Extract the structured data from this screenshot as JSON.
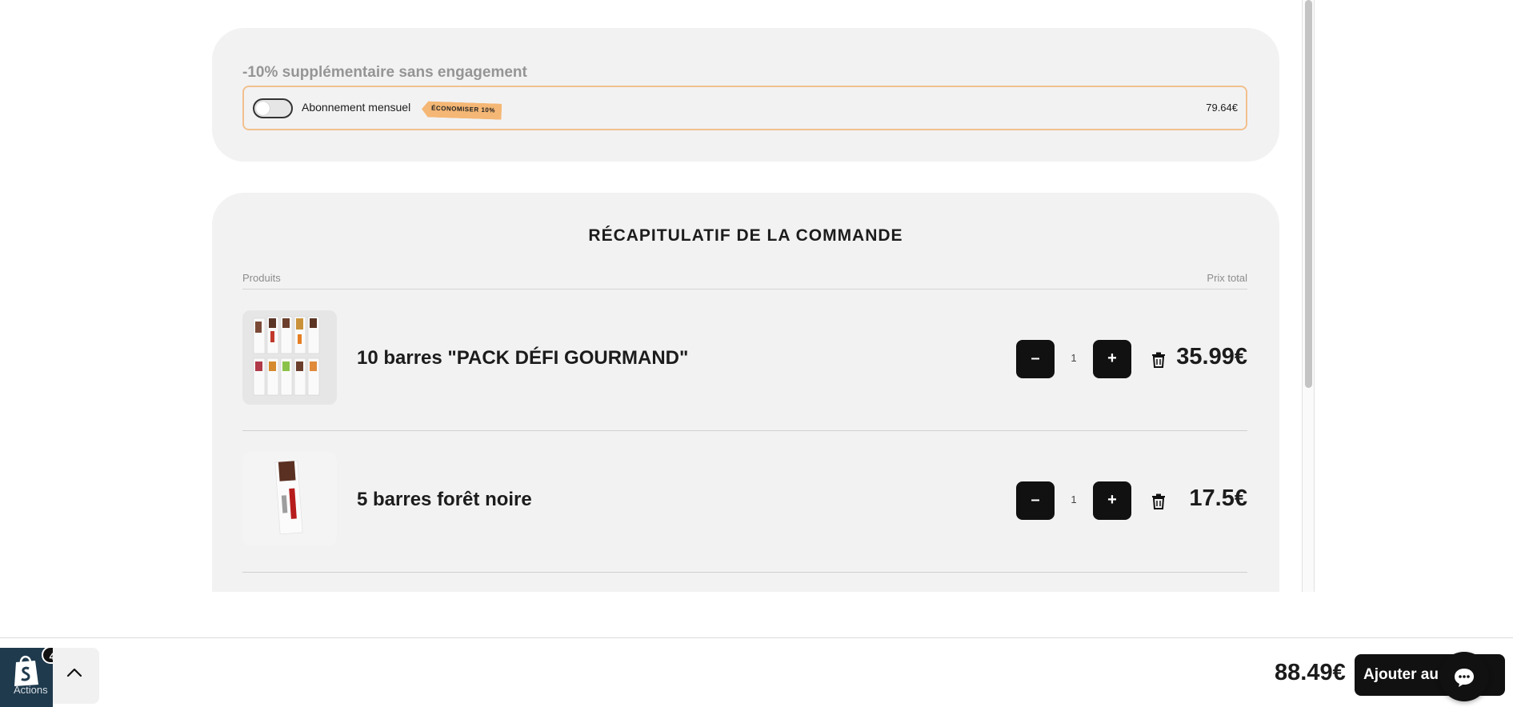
{
  "subscription": {
    "title": "-10% supplémentaire sans engagement",
    "toggle_label": "Abonnement mensuel",
    "tag": "ÉCONOMISER 10%",
    "price": "79.64€"
  },
  "summary": {
    "title": "RÉCAPITULATIF DE LA COMMANDE",
    "col_products": "Produits",
    "col_total": "Prix total",
    "items": [
      {
        "name": "10 barres \"PACK DÉFI GOURMAND\"",
        "qty": "1",
        "price": "35.99€",
        "minus": "–",
        "plus": "+"
      },
      {
        "name": "5 barres forêt noire",
        "qty": "1",
        "price": "17.5€",
        "minus": "–",
        "plus": "+"
      }
    ]
  },
  "footer": {
    "total": "88.49€",
    "add_to_cart": "Ajouter au panier",
    "shopify_label": "Actions",
    "badge_count": "4"
  },
  "colors": {
    "accent_tag": "#f5b775",
    "card_bg": "#f2f2f3",
    "button_bg": "#111111"
  }
}
